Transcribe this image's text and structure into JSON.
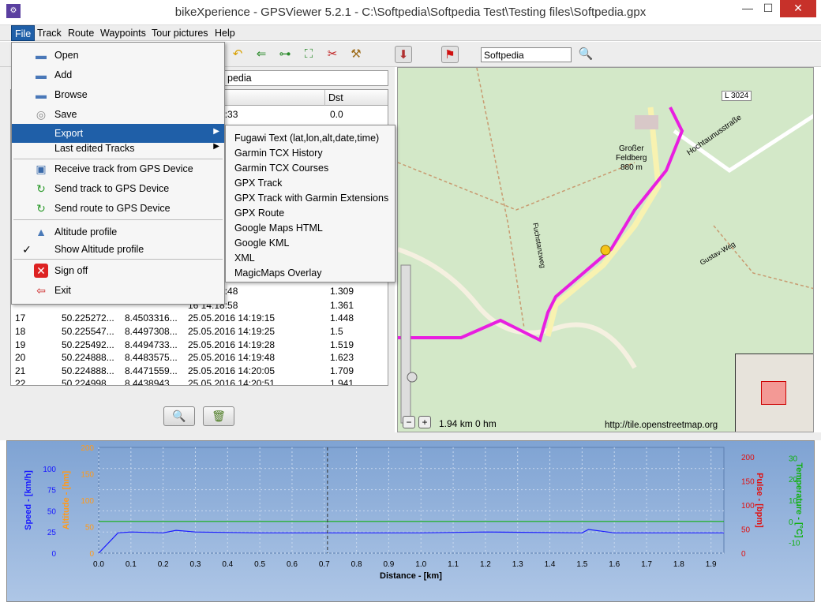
{
  "window": {
    "title": "bikeXperience - GPSViewer 5.2.1 - C:\\Softpedia\\Softpedia Test\\Testing files\\Softpedia.gpx",
    "minimize": "—",
    "maximize": "☐",
    "close": "✕"
  },
  "menubar": [
    "File",
    "Track",
    "Route",
    "Waypoints",
    "Tour pictures",
    "Help"
  ],
  "toolbar": {
    "search_value": "Softpedia",
    "icons": [
      "undo-icon",
      "prev-icon",
      "link-icon",
      "fit-icon",
      "cut-icon",
      "tool-icon",
      "gps-icon",
      "flag-icon",
      "search-icon"
    ]
  },
  "track_name_value": "pedia",
  "table": {
    "headers": [
      "Dst"
    ],
    "rows": [
      {
        "id": "",
        "lat": "",
        "lon": "",
        "time": "16 14:14:33",
        "dst": "0.0"
      },
      {
        "id": "",
        "lat": "",
        "lon": "",
        "time": "16 14:18:48",
        "dst": "1.309"
      },
      {
        "id": "",
        "lat": "",
        "lon": "",
        "time": "16 14:18:58",
        "dst": "1.361"
      },
      {
        "id": "17",
        "lat": "50.225272...",
        "lon": "8.4503316...",
        "time": "25.05.2016 14:19:15",
        "dst": "1.448"
      },
      {
        "id": "18",
        "lat": "50.225547...",
        "lon": "8.4497308...",
        "time": "25.05.2016 14:19:25",
        "dst": "1.5"
      },
      {
        "id": "19",
        "lat": "50.225492...",
        "lon": "8.4494733...",
        "time": "25.05.2016 14:19:28",
        "dst": "1.519"
      },
      {
        "id": "20",
        "lat": "50.224888...",
        "lon": "8.4483575...",
        "time": "25.05.2016 14:19:48",
        "dst": "1.623"
      },
      {
        "id": "21",
        "lat": "50.224888...",
        "lon": "8.4471559...",
        "time": "25.05.2016 14:20:05",
        "dst": "1.709"
      },
      {
        "id": "22",
        "lat": "50.224998...",
        "lon": "8.4438943...",
        "time": "25.05.2016 14:20:51",
        "dst": "1.941"
      }
    ]
  },
  "file_menu": {
    "items": [
      {
        "label": "Open",
        "icon": "folder-open-icon"
      },
      {
        "label": "Add",
        "icon": "folder-add-icon"
      },
      {
        "label": "Browse",
        "icon": "folder-browse-icon"
      },
      {
        "label": "Save",
        "icon": "disc-save-icon"
      },
      {
        "label": "Export",
        "icon": ""
      },
      {
        "label": "Last edited Tracks",
        "icon": ""
      },
      {
        "label": "Receive track from GPS Device",
        "icon": "gps-receive-icon"
      },
      {
        "label": "Send track to GPS Device",
        "icon": "gps-send-icon"
      },
      {
        "label": "Send route to GPS Device",
        "icon": "gps-send-route-icon"
      },
      {
        "label": "Altitude profile",
        "icon": "mountain-icon"
      },
      {
        "label": "Show Altitude profile",
        "icon": "check-icon"
      },
      {
        "label": "Sign off",
        "icon": "sign-off-icon"
      },
      {
        "label": "Exit",
        "icon": "exit-icon"
      }
    ]
  },
  "export_menu": {
    "items": [
      "Fugawi Text (lat,lon,alt,date,time)",
      "Garmin TCX History",
      "Garmin TCX Courses",
      "GPX Track",
      "GPX Track with Garmin Extensions",
      "GPX Route",
      "Google Maps HTML",
      "Google KML",
      "XML",
      "MagicMaps Overlay"
    ]
  },
  "map": {
    "labels": [
      "L 3024",
      "Großer",
      "Feldberg",
      "880 m",
      "Hochtaunusstraße",
      "Fuchstanzweg",
      "Gustav-Weg"
    ],
    "scale": "1.94 km 0 hm",
    "attribution": "http://tile.openstreetmap.org"
  },
  "chart_data": {
    "type": "line",
    "xlabel": "Distance - [km]",
    "x_ticks": [
      0.0,
      0.1,
      0.2,
      0.3,
      0.4,
      0.5,
      0.6,
      0.7,
      0.8,
      0.9,
      1.0,
      1.1,
      1.2,
      1.3,
      1.4,
      1.5,
      1.6,
      1.7,
      1.8,
      1.9
    ],
    "xlim": [
      0.0,
      1.94
    ],
    "axes": [
      {
        "label": "Speed - [km/h]",
        "color": "#1a1aff",
        "ticks": [
          0,
          25,
          50,
          75,
          100
        ],
        "ylim": [
          0,
          125
        ]
      },
      {
        "label": "Altitude - [hm]",
        "color": "#ff9a1a",
        "ticks": [
          0,
          50,
          100,
          150,
          200
        ],
        "ylim": [
          0,
          200
        ]
      },
      {
        "label": "Pulse - [bpm]",
        "color": "#e01010",
        "ticks": [
          0,
          50,
          100,
          150,
          200
        ],
        "ylim": [
          0,
          220
        ]
      },
      {
        "label": "Temperature - [°C]",
        "color": "#10b010",
        "ticks": [
          -10,
          0,
          10,
          20,
          30
        ],
        "ylim": [
          -15,
          35
        ]
      }
    ],
    "series": [
      {
        "name": "Speed",
        "color": "#1a1aff",
        "x": [
          0.0,
          0.06,
          0.1,
          0.2,
          0.24,
          0.3,
          0.5,
          0.7,
          1.0,
          1.2,
          1.5,
          1.52,
          1.6,
          1.94
        ],
        "y": [
          0,
          24,
          25,
          24,
          27,
          25,
          24,
          24,
          24,
          25,
          24,
          28,
          24,
          24
        ]
      },
      {
        "name": "Temperature",
        "color": "#10b010",
        "x": [
          0.0,
          1.94
        ],
        "y": [
          0,
          0
        ]
      }
    ],
    "cursor_x": 0.71
  }
}
